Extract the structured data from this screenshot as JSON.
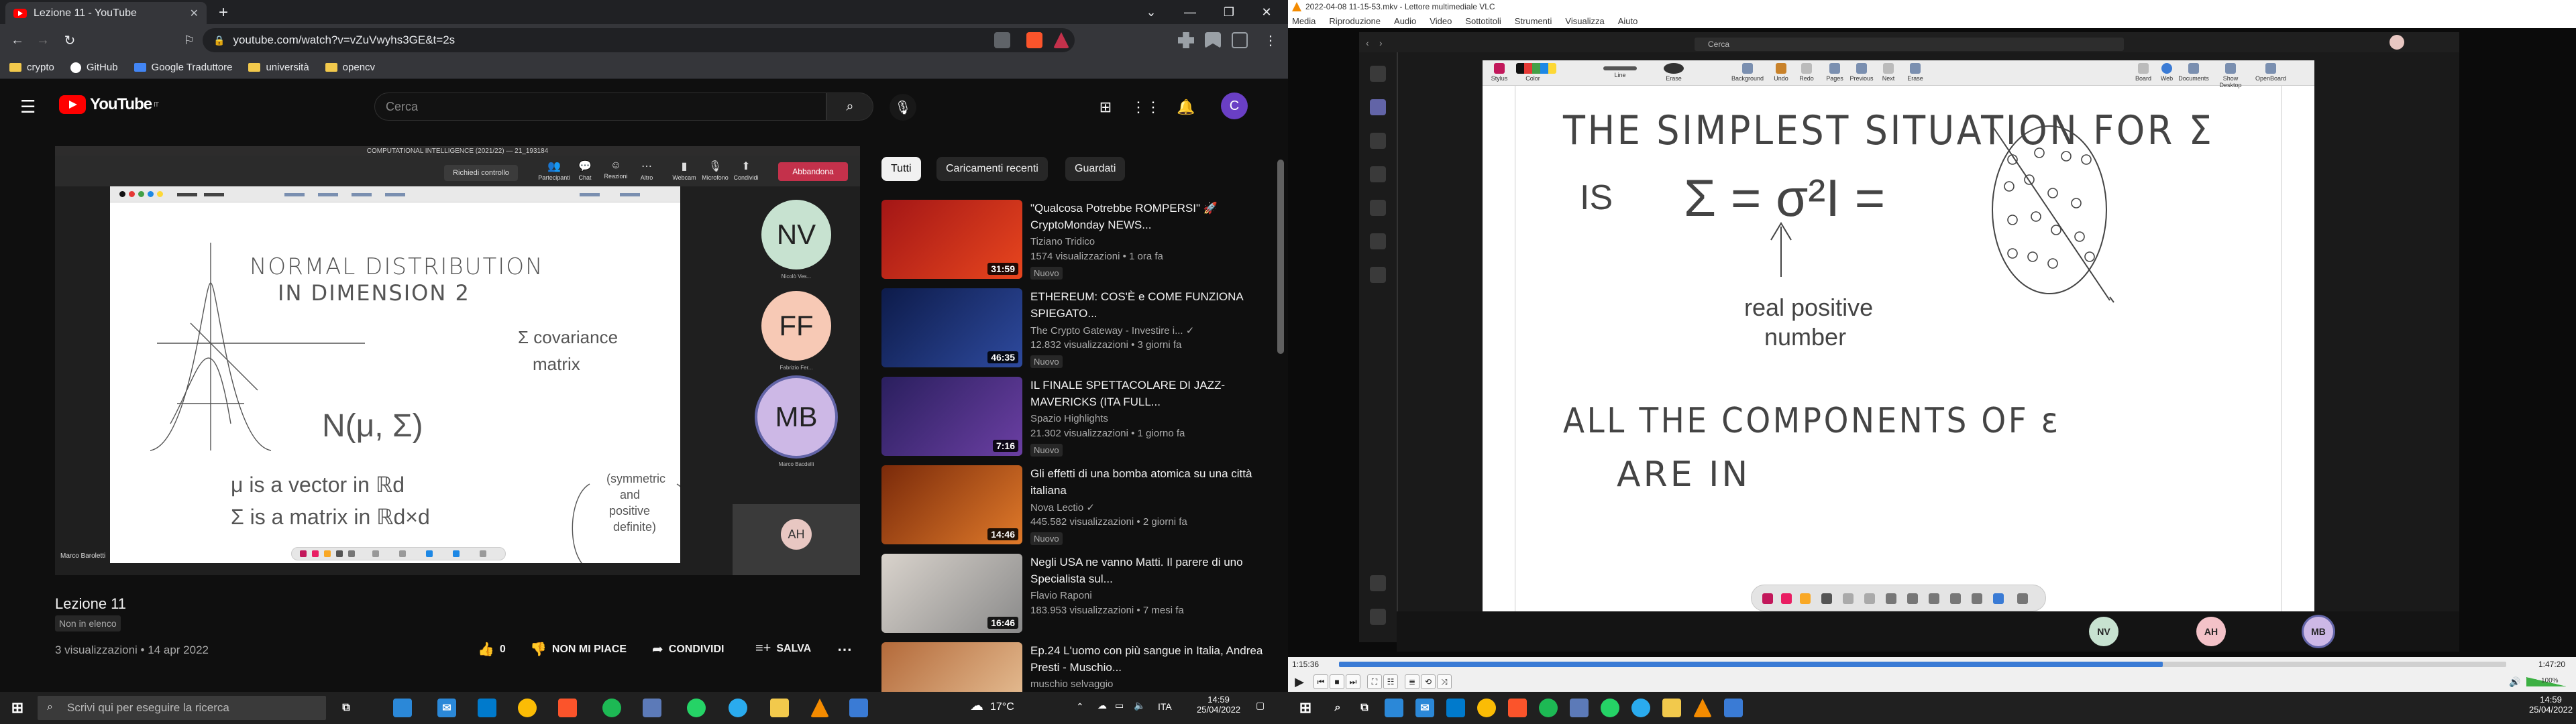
{
  "browser": {
    "tab_title": "Lezione 11 - YouTube",
    "url": "youtube.com/watch?v=vZuVwyhs3GE&t=2s",
    "bookmarks": [
      "crypto",
      "GitHub",
      "Google Traduttore",
      "università",
      "opencv"
    ]
  },
  "youtube": {
    "logo_text": "YouTube",
    "logo_region": "IT",
    "search_placeholder": "Cerca",
    "avatar_letter": "C",
    "player": {
      "meeting_title": "COMPUTATIONAL INTELLIGENCE (2021/22) — 21_193184",
      "request_control": "Richiedi controllo",
      "toolbar": [
        "Partecipanti",
        "Chat",
        "Reazioni",
        "Altro",
        "Webcam",
        "Microfono",
        "Condividi"
      ],
      "leave": "Abbandona",
      "whiteboard_text": {
        "line1": "NORMAL DISTRIBUTION",
        "line2": "IN DIMENSION 2",
        "sigma": "Σ covariance",
        "matrix": "matrix",
        "formula": "N(μ, Σ)",
        "mu": "μ is a vector in ℝd",
        "sig": "Σ is a matrix in ℝd×d",
        "sym": "(symmetric",
        "and": "and",
        "pos": "positive",
        "def": "definite)"
      },
      "participants": [
        {
          "initials": "NV",
          "name": "Nicolò Ves...",
          "color": "#c7e2d0"
        },
        {
          "initials": "FF",
          "name": "Fabrizio Fer...",
          "color": "#f7c9b5"
        },
        {
          "initials": "MB",
          "name": "Marco Bacdelli",
          "color": "#cdb8e6"
        }
      ],
      "small_participant": "AH",
      "presenter": "Marco Baroletti"
    },
    "video": {
      "title": "Lezione 11",
      "badge": "Non in elenco",
      "meta": "3 visualizzazioni • 14 apr 2022",
      "likes": "0",
      "dislike": "NON MI PIACE",
      "share": "CONDIVIDI",
      "save": "SALVA"
    },
    "chips": [
      "Tutti",
      "Caricamenti recenti",
      "Guardati"
    ],
    "recommendations": [
      {
        "title": "\"Qualcosa Potrebbe ROMPERSI\" 🚀 CryptoMonday NEWS...",
        "channel": "Tiziano Tridico",
        "views": "1574 visualizzazioni • 1 ora fa",
        "badge": "Nuovo",
        "duration": "31:59",
        "thumb": "#a31616"
      },
      {
        "title": "ETHEREUM: COS'È e COME FUNZIONA SPIEGATO...",
        "channel": "The Crypto Gateway - Investire i... ✓",
        "views": "12.832 visualizzazioni • 3 giorni fa",
        "badge": "Nuovo",
        "duration": "46:35",
        "thumb": "#1d2b5c"
      },
      {
        "title": "IL FINALE SPETTACOLARE DI JAZZ-MAVERICKS (ITA FULL...",
        "channel": "Spazio Highlights",
        "views": "21.302 visualizzazioni • 1 giorno fa",
        "badge": "Nuovo",
        "duration": "7:16",
        "thumb": "#3b2a6e"
      },
      {
        "title": "Gli effetti di una bomba atomica su una città italiana",
        "channel": "Nova Lectio ✓",
        "views": "445.582 visualizzazioni • 2 giorni fa",
        "badge": "Nuovo",
        "duration": "14:46",
        "thumb": "#c2541a"
      },
      {
        "title": "Negli USA ne vanno Matti. Il parere di uno Specialista sul...",
        "channel": "Flavio Raponi",
        "views": "183.953 visualizzazioni • 7 mesi fa",
        "badge": "",
        "duration": "16:46",
        "thumb": "#d9d3cc"
      },
      {
        "title": "Ep.24 L'uomo con più sangue in Italia, Andrea Presti - Muschio...",
        "channel": "muschio selvaggio",
        "views": "",
        "badge": "",
        "duration": "",
        "thumb": "#b46a3a"
      }
    ]
  },
  "taskbar_left": {
    "search_placeholder": "Scrivi qui per eseguire la ricerca",
    "weather": "17°C",
    "lang": "ITA",
    "time": "14:59",
    "date": "25/04/2022"
  },
  "vlc": {
    "title": "2022-04-08 11-15-53.mkv - Lettore multimediale VLC",
    "menu": [
      "Media",
      "Riproduzione",
      "Audio",
      "Video",
      "Sottotitoli",
      "Strumenti",
      "Visualizza",
      "Aiuto"
    ],
    "teams_search": "Cerca",
    "whiteboard_tools": [
      "Stylus",
      "Color",
      "Line",
      "Erase",
      "Background",
      "Undo",
      "Redo",
      "Pages",
      "Previous",
      "Next",
      "Erase",
      "Board",
      "Web",
      "Documents",
      "Show Desktop",
      "OpenBoard"
    ],
    "whiteboard_text": {
      "l1": "THE SIMPLEST SITUATION FOR Σ",
      "is": "IS",
      "eq": "Σ = σ²I =",
      "real": "real positive",
      "number": "number",
      "l2": "ALL THE COMPONENTS OF ε",
      "l3": "ARE IN"
    },
    "participants": [
      {
        "initials": "NV",
        "color": "#c7e2d0"
      },
      {
        "initials": "AH",
        "color": "#f3c2c8"
      },
      {
        "initials": "MB",
        "color": "#cdb8e6"
      }
    ],
    "time_elapsed": "1:15:36",
    "time_total": "1:47:20",
    "progress": 0.706,
    "volume": "100%"
  },
  "taskbar_right": {
    "time": "14:59",
    "date": "25/04/2022"
  }
}
